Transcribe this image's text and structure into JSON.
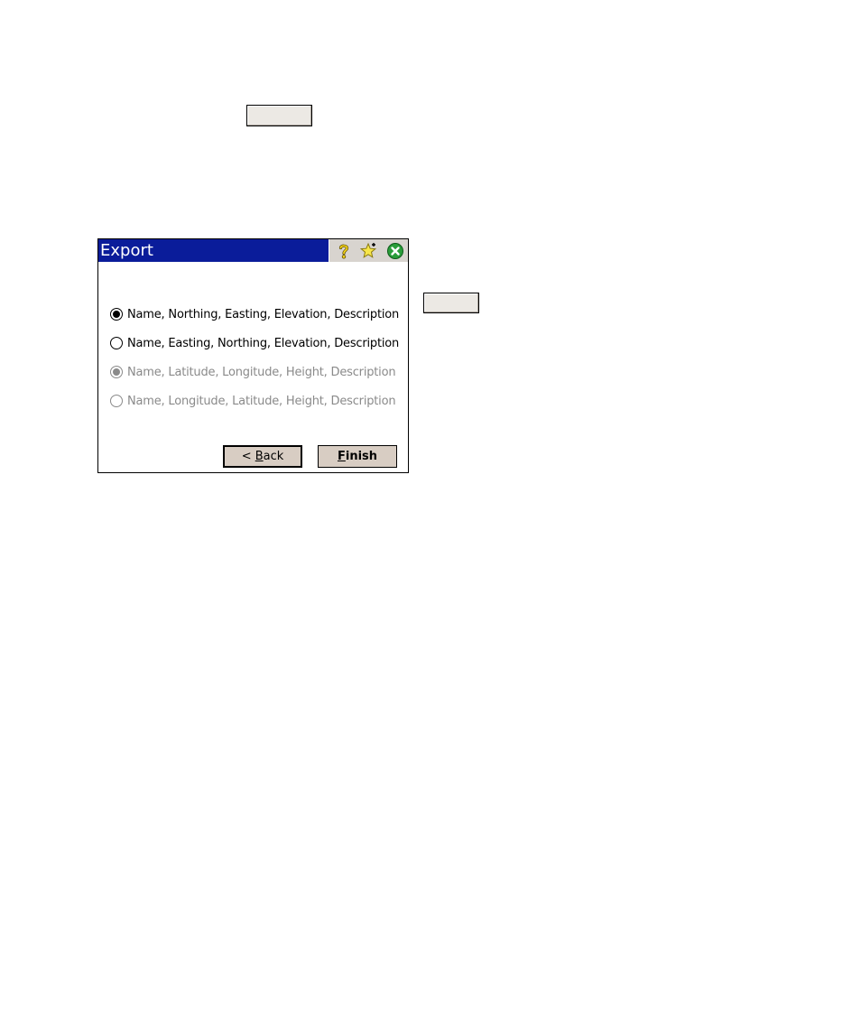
{
  "dialog": {
    "title": "Export",
    "icons": [
      "help-icon",
      "star-icon",
      "close-icon"
    ],
    "options": [
      {
        "label": "Name, Northing, Easting, Elevation, Description",
        "selected": true,
        "enabled": true
      },
      {
        "label": "Name, Easting, Northing, Elevation, Description",
        "selected": false,
        "enabled": true
      },
      {
        "label": "Name, Latitude, Longitude, Height, Description",
        "selected": true,
        "enabled": false
      },
      {
        "label": "Name, Longitude, Latitude, Height, Description",
        "selected": false,
        "enabled": false
      }
    ],
    "back_button": {
      "prefix": "< ",
      "mnemonic": "B",
      "rest": "ack"
    },
    "finish_button": {
      "mnemonic": "F",
      "rest": "inish"
    }
  },
  "colors": {
    "titlebar": "#0a1c9a",
    "button_face": "#d8cdc3",
    "disabled_text": "#8a8a8a"
  }
}
